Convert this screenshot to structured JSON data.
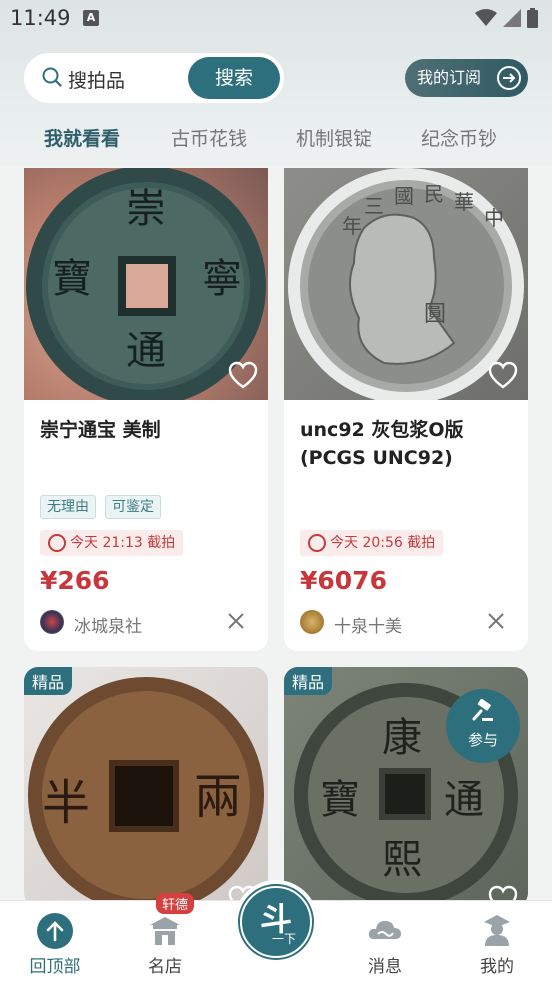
{
  "status_bar": {
    "time": "11:49",
    "notification_icon_letter": "A"
  },
  "search": {
    "placeholder": "搜拍品",
    "button": "搜索"
  },
  "subscribe": {
    "label": "我的订阅"
  },
  "tabs": [
    {
      "label": "我就看看",
      "active": true
    },
    {
      "label": "古币花钱",
      "active": false
    },
    {
      "label": "机制银锭",
      "active": false
    },
    {
      "label": "纪念币钞",
      "active": false
    }
  ],
  "cards": [
    {
      "title": "崇宁通宝 美制",
      "tags": [
        "无理由",
        "可鉴定"
      ],
      "deadline": "今天 21:13 截拍",
      "price": "¥266",
      "seller": "冰城泉社",
      "coin_text": [
        "崇",
        "寧",
        "通",
        "寶"
      ]
    },
    {
      "title": "unc92 灰包浆O版 (PCGS UNC92)",
      "tags": [],
      "deadline": "今天 20:56 截拍",
      "price": "¥6076",
      "seller": "十泉十美",
      "coin_text": [
        "中",
        "華",
        "民",
        "國",
        "三",
        "年",
        "圓"
      ]
    },
    {
      "badge": "精品",
      "coin_text": [
        "半",
        "兩"
      ]
    },
    {
      "badge": "精品",
      "participate": "参与",
      "coin_text": [
        "康",
        "通",
        "熙",
        "寶"
      ]
    }
  ],
  "bottom_nav": {
    "items": [
      {
        "label": "回顶部",
        "icon": "up-arrow-icon",
        "active": true
      },
      {
        "label": "名店",
        "icon": "shop-icon",
        "badge": "轩德",
        "active": false
      },
      {
        "label": "消息",
        "icon": "cloud-icon",
        "active": false
      },
      {
        "label": "我的",
        "icon": "person-icon",
        "active": false
      }
    ],
    "center": {
      "main": "斗",
      "sub": "一下"
    }
  },
  "colors": {
    "accent": "#2e6f7e",
    "price": "#c8353a",
    "badge_red": "#d5403f"
  }
}
